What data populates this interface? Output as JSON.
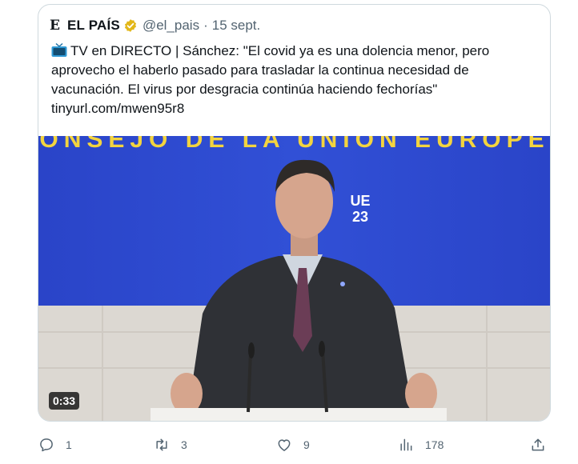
{
  "tweet": {
    "author_logo": "E",
    "author_name": "EL PAÍS",
    "handle": "@el_pais",
    "separator": "·",
    "date": "15 sept.",
    "text": "TV en DIRECTO | Sánchez: \"El covid ya es una dolencia menor, pero aprovecho el haberlo pasado para trasladar la continua necesidad de vacunación. El virus por desgracia continúa haciendo fechorías\" tinyurl.com/mwen95r8",
    "text_icon": "tv-icon"
  },
  "video": {
    "banner_text": "CONSEJO DE LA UNIÓN EUROPEA",
    "logo_line1": "UE",
    "logo_line2": "23",
    "duration": "0:33"
  },
  "actions": {
    "replies": "1",
    "retweets": "3",
    "likes": "9",
    "views": "178"
  },
  "colors": {
    "verified_badge": "#e2b719",
    "muted_text": "#536471",
    "stage_blue": "#2b47cf",
    "banner_yellow": "#f3d43f"
  }
}
